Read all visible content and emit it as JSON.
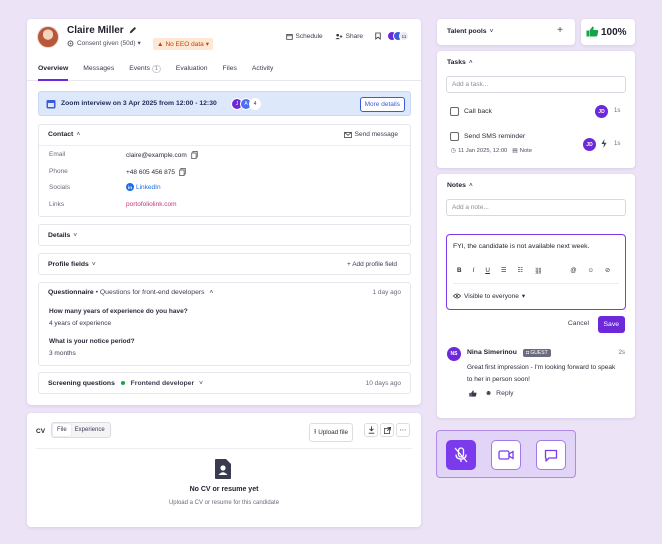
{
  "profile": {
    "name": "Claire Miller",
    "consent": "Consent given (50d)",
    "eeo_badge": "No EEO data",
    "actions": {
      "schedule": "Schedule",
      "share": "Share",
      "collaborators_count": "11"
    },
    "tabs": [
      {
        "label": "Overview",
        "active": true
      },
      {
        "label": "Messages"
      },
      {
        "label": "Events",
        "count": "1"
      },
      {
        "label": "Evaluation"
      },
      {
        "label": "Files"
      },
      {
        "label": "Activity"
      }
    ]
  },
  "zoom_banner": {
    "text": "Zoom interview on 3 Apr 2025 from 12:00 - 12:30",
    "avatars": [
      "J",
      "A"
    ],
    "extra_count": "4",
    "button": "More details"
  },
  "contact": {
    "title": "Contact",
    "send_message": "Send message",
    "fields": {
      "email_label": "Email",
      "email_value": "claire@example.com",
      "phone_label": "Phone",
      "phone_value": "+48 605 456 875",
      "socials_label": "Socials",
      "socials_value": "LinkedIn",
      "links_label": "Links",
      "links_value": "portofoliolink.com"
    }
  },
  "details": {
    "title": "Details"
  },
  "profile_fields": {
    "title": "Profile fields",
    "add": "Add profile field"
  },
  "questionnaire": {
    "title": "Questionnaire",
    "subtitle": "Questions for front-end developers",
    "date": "1 day ago",
    "items": [
      {
        "question": "How many years of experience do you have?",
        "answer": "4 years of experience"
      },
      {
        "question": "What is your notice period?",
        "answer": "3 months"
      }
    ]
  },
  "screening": {
    "title": "Screening questions",
    "role": "Frontend developer",
    "date": "10 days ago"
  },
  "cv": {
    "label": "CV",
    "toggle": [
      "File",
      "Experience"
    ],
    "upload": "Upload file",
    "empty_title": "No CV or resume yet",
    "empty_subtitle": "Upload a CV or resume for this candidate"
  },
  "talent_pools": {
    "label": "Talent pools",
    "plus": "+"
  },
  "score": {
    "value": "100%"
  },
  "tasks": {
    "title": "Tasks",
    "placeholder": "Add a task...",
    "items": [
      {
        "label": "Call back",
        "assignee": "JD",
        "time": "1s"
      },
      {
        "label": "Send SMS reminder",
        "assignee": "JD",
        "time": "1s",
        "date": "11 Jan 2025, 12:00",
        "note": "Note"
      }
    ]
  },
  "notes": {
    "title": "Notes",
    "placeholder": "Add a note...",
    "draft": "FYI, the candidate is not available next week.",
    "visibility": "Visible to everyone",
    "cancel": "Cancel",
    "save": "Save",
    "comment": {
      "initials": "NS",
      "author": "Nina Simerinou",
      "badge": "GUEST",
      "time": "2s",
      "text": "Great first impression - I'm looking forward to speak to her in person soon!",
      "reply": "Reply"
    }
  },
  "colors": {
    "accent": "#6d28d9",
    "page_bg": "#ece3f6",
    "banner_bg": "#dde8fb",
    "eeo_text": "#c2410c"
  }
}
